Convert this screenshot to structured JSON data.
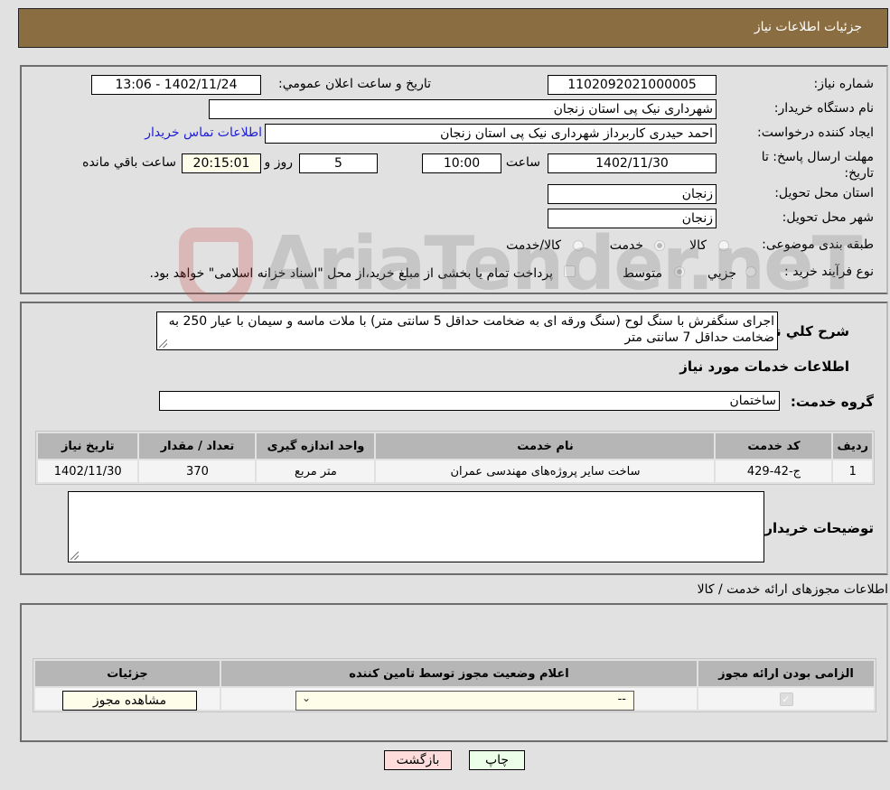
{
  "header": {
    "title": "جزئیات اطلاعات نیاز"
  },
  "need_info": {
    "need_number_label": "شماره نیاز:",
    "need_number": "1102092021000005",
    "announce_label": "تاريخ و ساعت اعلان عمومي:",
    "announce_value": "1402/11/24 - 13:06",
    "buyer_org_label": "نام دستگاه خریدار:",
    "buyer_org": "شهرداری نیک پی استان زنجان",
    "requester_label": "ایجاد کننده درخواست:",
    "requester": "احمد حیدری کاربرداز شهرداری نیک پی استان زنجان",
    "buyer_contact_link": "اطلاعات تماس خریدار",
    "deadline_label": "مهلت ارسال پاسخ: تا تاریخ:",
    "deadline_date": "1402/11/30",
    "time_label": "ساعت",
    "deadline_time": "10:00",
    "days_remaining": "5",
    "days_label": "روز و",
    "time_remaining": "20:15:01",
    "time_remaining_label": "ساعت باقي مانده",
    "province_label": "استان محل تحویل:",
    "province": "زنجان",
    "city_label": "شهر محل تحویل:",
    "city": "زنجان",
    "category_label": "طبقه بندی موضوعی:",
    "category_options": [
      {
        "label": "کالا",
        "checked": false
      },
      {
        "label": "خدمت",
        "checked": true
      },
      {
        "label": "کالا/خدمت",
        "checked": false
      }
    ],
    "process_label": "نوع فرآیند خرید :",
    "process_options": [
      {
        "label": "جزيي",
        "checked": false
      },
      {
        "label": "متوسط",
        "checked": true
      }
    ],
    "treasury_note": "پرداخت تمام یا بخشی از مبلغ خرید،از محل \"اسناد خزانه اسلامی\" خواهد بود."
  },
  "description": {
    "label": "شرح کلي نياز:",
    "text": "اجرای سنگفرش با سنگ لوح (سنگ ورقه ای  به ضخامت حداقل 5 سانتی متر) با ملات ماسه و سیمان با عیار 250 به ضخامت حداقل 7 سانتی متر",
    "services_title": "اطلاعات خدمات مورد نیاز",
    "service_group_label": "گروه خدمت:",
    "service_group": "ساختمان"
  },
  "services_table": {
    "headers": [
      "ردیف",
      "کد خدمت",
      "نام خدمت",
      "واحد اندازه گیری",
      "تعداد / مقدار",
      "تاریخ نیاز"
    ],
    "rows": [
      [
        "1",
        "ج-42-429",
        "ساخت سایر پروژه‌های مهندسی عمران",
        "متر مربع",
        "370",
        "1402/11/30"
      ]
    ]
  },
  "buyer_notes": {
    "label": "توضیحات خریدار:",
    "value": ""
  },
  "permits": {
    "title": "اطلاعات مجوزهای ارائه خدمت / کالا",
    "headers": [
      "الزامی بودن ارائه مجوز",
      "اعلام وضعیت مجوز توسط تامین کننده",
      "جزئیات"
    ],
    "row": {
      "required_checked": true,
      "status_value": "--",
      "details_button": "مشاهده مجوز"
    }
  },
  "footer": {
    "print_button": "چاپ",
    "back_button": "بازگشت"
  },
  "watermark": "AriaTender.neT"
}
